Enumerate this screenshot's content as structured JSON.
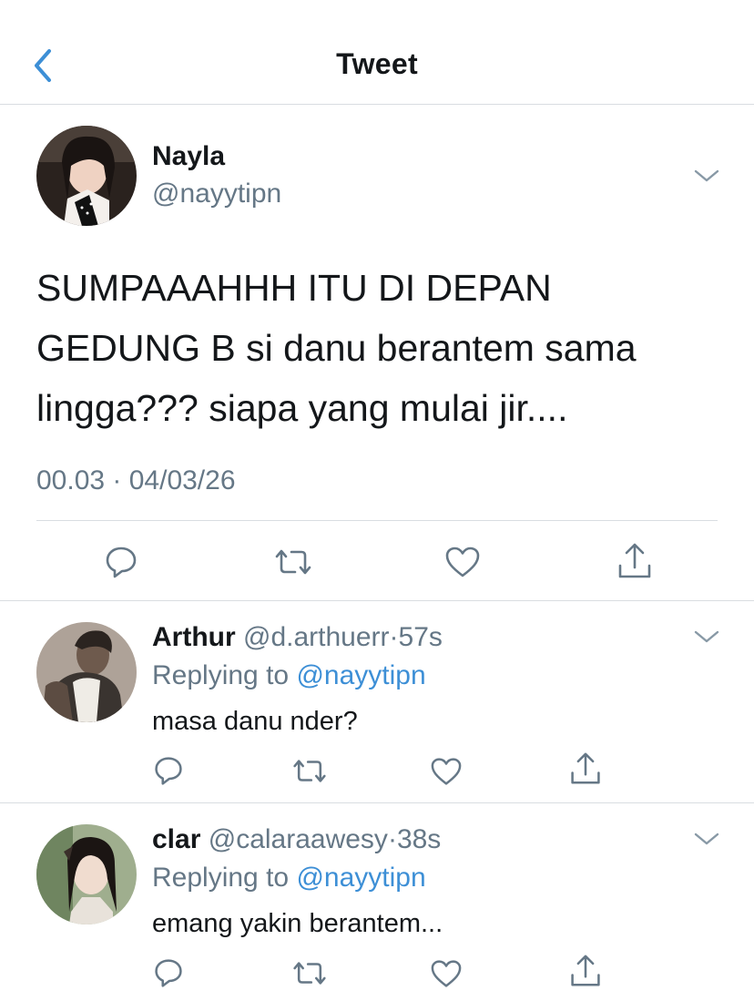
{
  "header": {
    "title": "Tweet",
    "back_icon": "chevron-left-icon"
  },
  "tweet": {
    "name": "Nayla",
    "handle": "@nayytipn",
    "text_lines": [
      "SUMPAAAHHH ITU DI DEPAN",
      "GEDUNG B si danu berantem sama",
      "lingga??? siapa yang mulai jir...."
    ],
    "timestamp": "00.03 · 04/03/26",
    "actions": [
      "reply-icon",
      "retweet-icon",
      "like-icon",
      "share-icon"
    ]
  },
  "replies": [
    {
      "name": "Arthur",
      "handle": "@d.arthuerr",
      "separator": "·",
      "age": "57s",
      "replying_prefix": "Replying to",
      "replying_to": "@nayytipn",
      "text": "masa danu nder?"
    },
    {
      "name": "clar",
      "handle": "@calaraawesy",
      "separator": "·",
      "age": "38s",
      "replying_prefix": "Replying to",
      "replying_to": "@nayytipn",
      "text": "emang yakin berantem..."
    }
  ],
  "colors": {
    "accent": "#3d8fd6",
    "secondary_text": "#657786",
    "divider": "#d9dde1"
  }
}
